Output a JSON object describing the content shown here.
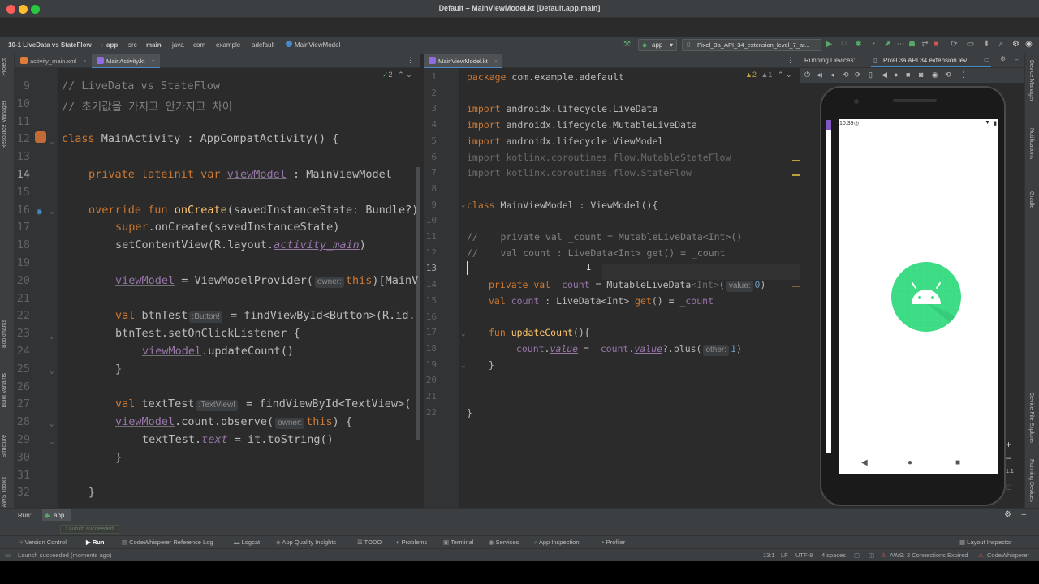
{
  "window": {
    "title": "Default – MainViewModel.kt [Default.app.main]"
  },
  "breadcrumb": [
    "10-1 LiveData vs StateFlow",
    "app",
    "src",
    "main",
    "java",
    "com",
    "example",
    "adefault",
    "MainViewModel"
  ],
  "toolbar": {
    "run_config": "app",
    "device": "Pixel_3a_API_34_extension_level_7_ar..."
  },
  "left_strip": [
    "Project",
    "Resource Manager",
    "Bookmarks",
    "Build Variants",
    "Structure",
    "AWS Toolkit"
  ],
  "right_strip": [
    "Device Manager",
    "Notifications",
    "Gradle",
    "Device File Explorer",
    "Running Devices"
  ],
  "left_tabs": [
    "activity_main.xml",
    "MainActivity.kt"
  ],
  "left_editor": {
    "inspection": "2",
    "lines": [
      {
        "n": "9",
        "t": "// LiveData vs StateFlow"
      },
      {
        "n": "10",
        "t": "// 초기값을 가지고 안가지고 차이"
      },
      {
        "n": "11",
        "t": ""
      },
      {
        "n": "12",
        "a": "class",
        "b": " MainActivity : AppCompatActivity() {"
      },
      {
        "n": "13",
        "t": ""
      },
      {
        "n": "14",
        "a": "private lateinit var",
        "b": "viewModel",
        "c": " : MainViewModel"
      },
      {
        "n": "15",
        "t": ""
      },
      {
        "n": "16",
        "a": "override fun",
        "b": "onCreate",
        "c": "(savedInstanceState: Bundle?)"
      },
      {
        "n": "17",
        "a": "super",
        "b": ".onCreate(savedInstanceState)"
      },
      {
        "n": "18",
        "a": "setContentView(R.layout.",
        "b": "activity_main",
        "c": ")"
      },
      {
        "n": "19",
        "t": ""
      },
      {
        "n": "20",
        "a": "viewModel",
        "b": " = ViewModelProvider(",
        "h": "owner:",
        "c": "this",
        "d": ")[MainV"
      },
      {
        "n": "21",
        "t": ""
      },
      {
        "n": "22",
        "a": "val",
        "b": " btnTest",
        "h": ":Button!",
        "c": " = findViewById<Button>(R.id."
      },
      {
        "n": "23",
        "a": "btnTest.setOnClickListener {"
      },
      {
        "n": "24",
        "a": "viewModel",
        "b": ".updateCount()"
      },
      {
        "n": "25",
        "a": "}"
      },
      {
        "n": "26",
        "t": ""
      },
      {
        "n": "27",
        "a": "val",
        "b": " textTest",
        "h": ":TextView!",
        "c": " = findViewById<TextView>("
      },
      {
        "n": "28",
        "a": "viewModel",
        "b": ".count.observe(",
        "h": "owner:",
        "c": "this",
        "d": ") {"
      },
      {
        "n": "29",
        "a": "textTest.",
        "b": "text",
        "c": " = it.toString()"
      },
      {
        "n": "30",
        "a": "}"
      },
      {
        "n": "31",
        "t": ""
      },
      {
        "n": "32",
        "a": "}"
      }
    ]
  },
  "right_tabs": [
    "MainViewModel.kt"
  ],
  "right_editor": {
    "inspection_warn": "2",
    "inspection_weak": "1",
    "lines": [
      {
        "n": "1",
        "a": "package",
        "b": " com.example.adefault"
      },
      {
        "n": "2",
        "t": ""
      },
      {
        "n": "3",
        "a": "import",
        "b": " androidx.lifecycle.LiveData"
      },
      {
        "n": "4",
        "a": "import",
        "b": " androidx.lifecycle.MutableLiveData"
      },
      {
        "n": "5",
        "a": "import",
        "b": " androidx.lifecycle.ViewModel"
      },
      {
        "n": "6",
        "t": "import kotlinx.coroutines.flow.MutableStateFlow"
      },
      {
        "n": "7",
        "t": "import kotlinx.coroutines.flow.StateFlow"
      },
      {
        "n": "8",
        "t": ""
      },
      {
        "n": "9",
        "a": "class",
        "b": " MainViewModel : ViewModel(){"
      },
      {
        "n": "10",
        "t": ""
      },
      {
        "n": "11",
        "t": "//    private val _count = MutableLiveData<Int>()"
      },
      {
        "n": "12",
        "t": "//    val count : LiveData<Int> get() = _count"
      },
      {
        "n": "13",
        "t": ""
      },
      {
        "n": "14",
        "a": "private val",
        "b": "_count",
        "c": " = MutableLiveData",
        "d": "<Int>",
        "e": "(",
        "h": "value:",
        "f": "0",
        "g": ")"
      },
      {
        "n": "15",
        "a": "val",
        "b": "count",
        "c": " : LiveData<Int> ",
        "d": "get",
        "e": "() = ",
        "f": "_count"
      },
      {
        "n": "16",
        "t": ""
      },
      {
        "n": "17",
        "a": "fun",
        "b": "updateCount",
        "c": "(){"
      },
      {
        "n": "18",
        "a": "_count",
        "b": ".",
        "c": "value",
        "d": " = ",
        "e": "_count",
        "f": ".",
        "g": "value",
        "h2": "?.plus(",
        "h": "other:",
        "i": "1",
        "j": ")"
      },
      {
        "n": "19",
        "a": "}"
      },
      {
        "n": "20",
        "t": ""
      },
      {
        "n": "21",
        "t": ""
      },
      {
        "n": "22",
        "a": "}"
      }
    ]
  },
  "running_devices": {
    "label": "Running Devices:",
    "device_tab": "Pixel 3a API 34 extension lev"
  },
  "phone": {
    "time": "10:39"
  },
  "run_panel": {
    "label": "Run:",
    "config": "app",
    "tooltip": "Launch succeeded"
  },
  "bottom_tabs": [
    "Version Control",
    "Run",
    "CodeWhisperer Reference Log",
    "Logcat",
    "App Quality Insights",
    "TODO",
    "Problems",
    "Terminal",
    "Services",
    "App Inspection",
    "Profiler",
    "Layout Inspector"
  ],
  "status": {
    "message": "Launch succeeded (moments ago)",
    "position": "13:1",
    "line_sep": "LF",
    "encoding": "UTF-8",
    "indent": "4 spaces",
    "aws": "AWS: 2 Connections Expired",
    "codewhisperer": "CodeWhisperer"
  },
  "colors": {
    "accent": "#4a88c7",
    "keyword": "#cc7832",
    "function": "#ffc66d",
    "property": "#9876aa",
    "number": "#6897bb",
    "comment": "#808080"
  }
}
